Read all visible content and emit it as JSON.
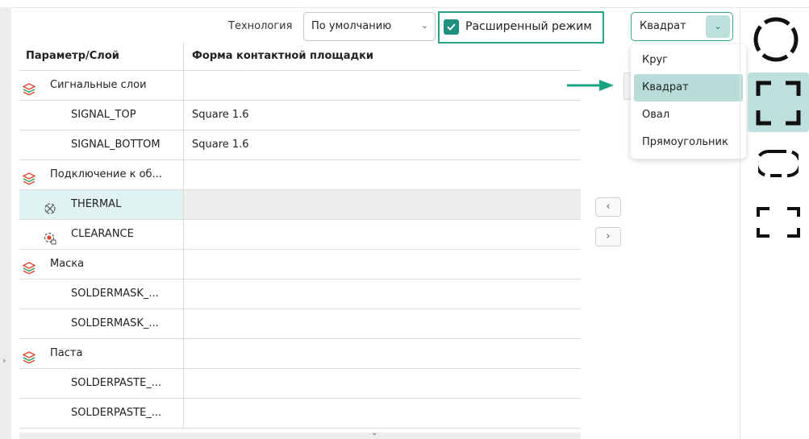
{
  "toolbar": {
    "technology_label": "Технология",
    "technology_value": "По умолчанию",
    "advanced_mode_label": "Расширенный режим",
    "advanced_mode_checked": true,
    "shape_value": "Квадрат"
  },
  "table": {
    "columns": [
      "Параметр/Слой",
      "Форма контактной площадки"
    ],
    "rows": [
      {
        "type": "group",
        "label": "Сигнальные слои",
        "value": ""
      },
      {
        "type": "child",
        "label": "SIGNAL_TOP",
        "value": "Square 1.6"
      },
      {
        "type": "child",
        "label": "SIGNAL_BOTTOM",
        "value": "Square 1.6"
      },
      {
        "type": "group",
        "label": "Подключение к об...",
        "value": ""
      },
      {
        "type": "child",
        "label": "THERMAL",
        "value": "",
        "icon": "thermal-icon",
        "selected": true
      },
      {
        "type": "child",
        "label": "CLEARANCE",
        "value": "",
        "icon": "clearance-icon"
      },
      {
        "type": "group",
        "label": "Маска",
        "value": ""
      },
      {
        "type": "child",
        "label": "SOLDERMASK_...",
        "value": ""
      },
      {
        "type": "child",
        "label": "SOLDERMASK_...",
        "value": ""
      },
      {
        "type": "group",
        "label": "Паста",
        "value": ""
      },
      {
        "type": "child",
        "label": "SOLDERPASTE_...",
        "value": ""
      },
      {
        "type": "child",
        "label": "SOLDERPASTE_...",
        "value": ""
      }
    ]
  },
  "shape_menu": {
    "items": [
      "Круг",
      "Квадрат",
      "Овал",
      "Прямоугольник"
    ],
    "active_index": 1
  },
  "icons": {
    "layers": "layers-icon",
    "arrow": "pointer-arrow",
    "nav_prev": "‹",
    "nav_next": "›"
  },
  "colors": {
    "accent": "#1f8f7e",
    "highlight": "#bde0dc",
    "arrow": "#1aa37f"
  }
}
